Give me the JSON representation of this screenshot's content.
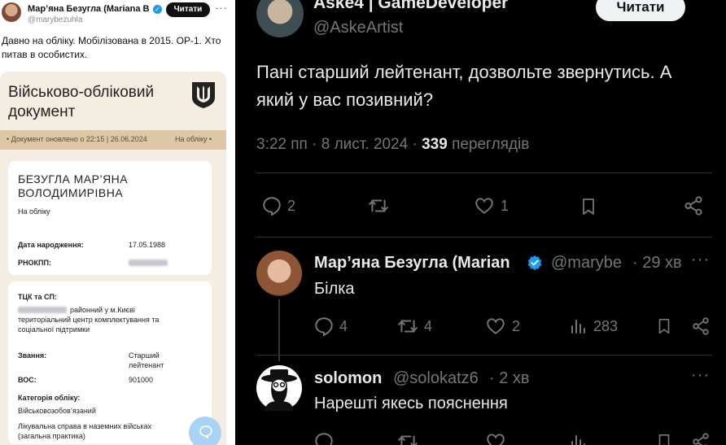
{
  "left_post": {
    "author_name": "Мар’яна Безугла (Mariana Be",
    "handle": "@marybezuhla",
    "follow_label": "Читати",
    "text": "Давно на обліку. Мобілізована в 2015. ОР-1. Хто питав в особистих.",
    "document": {
      "title": "Військово-обліковий документ",
      "updated_label": "• Документ оновлено о 22:15 | 26.06.2024",
      "updated_right": "На обліку •",
      "person_name_line1": "БЕЗУГЛА МАР’ЯНА",
      "person_name_line2": "ВОЛОДИМИРІВНА",
      "status": "На обліку",
      "dob_label": "Дата народження:",
      "dob_value": "17.05.1988",
      "rnokpp_label": "РНОКПП:",
      "tck_label": "ТЦК та СП:",
      "tck_value_line1": "районний у м.Києві",
      "tck_value_line2": "територіальний центр комплектування та",
      "tck_value_line3": "соціальної підтримки",
      "rank_label": "Звання:",
      "rank_value_line1": "Старший",
      "rank_value_line2": "лейтенант",
      "vos_label": "ВОС:",
      "vos_value": "901000",
      "category_label": "Категорія обліку:",
      "category_value": "Військовозобов’язаний",
      "commission_line1": "Лікувальна справа в наземних військах",
      "commission_line2": "(загальна практика)"
    }
  },
  "right_post": {
    "author_name": "Aske4 | GameDeveloper",
    "handle": "@AskeArtist",
    "follow_label": "Читати",
    "text": "Пані старший лейтенант, дозвольте звернутись. А який у вас позивний?",
    "time": "3:22 пп · 8 лист. 2024 ·",
    "views_count": "339",
    "views_label": "переглядів",
    "actions": {
      "replies": "2",
      "likes": "1"
    },
    "replies": [
      {
        "name": "Мар’яна Безугла (Marian",
        "handle": "@marybe",
        "time": "· 29 хв",
        "text": "Білка",
        "replies": "4",
        "retweets": "4",
        "likes": "2",
        "views": "283"
      },
      {
        "name": "solomon",
        "handle": "@solokatz6",
        "time": "· 2 хв",
        "text": "Нарешті якесь пояснення"
      }
    ]
  },
  "colors": {
    "x_blue": "#1d9bf0",
    "dark_bg": "#000000",
    "muted": "#71767b",
    "doc_beige": "#f3ede2",
    "doc_bar": "#dcc7a6"
  }
}
